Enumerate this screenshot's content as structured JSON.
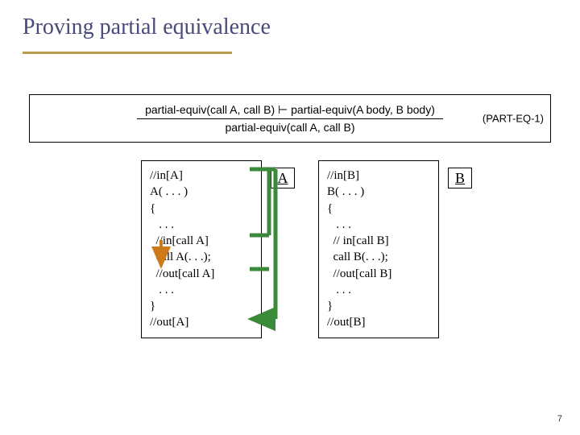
{
  "slide": {
    "title": "Proving partial equivalence",
    "page_number": "7"
  },
  "rule": {
    "top": "partial-equiv(call A, call B) ⊢ partial-equiv(A body, B body)",
    "bottom": "partial-equiv(call A, call B)",
    "name": "(PART-EQ-1)"
  },
  "codeA": {
    "badge": "A",
    "lines": {
      "l1": "//in[A]",
      "l2": "A( . . . )",
      "l3": "{",
      "l4": "   . . .",
      "l5": "  //in[call A]",
      "l6": "  call A(. . .);",
      "l7": "  //out[call A]",
      "l8": "   . . .",
      "l9": "}",
      "l10": "//out[A]"
    }
  },
  "codeB": {
    "badge": "B",
    "lines": {
      "l1": "//in[B]",
      "l2": "B( . . . )",
      "l3": "{",
      "l4": "   . . .",
      "l5": "  // in[call B]",
      "l6": "  call B(. . .);",
      "l7": "  //out[call B]",
      "l8": "   . . .",
      "l9": "}",
      "l10": "//out[B]"
    }
  }
}
